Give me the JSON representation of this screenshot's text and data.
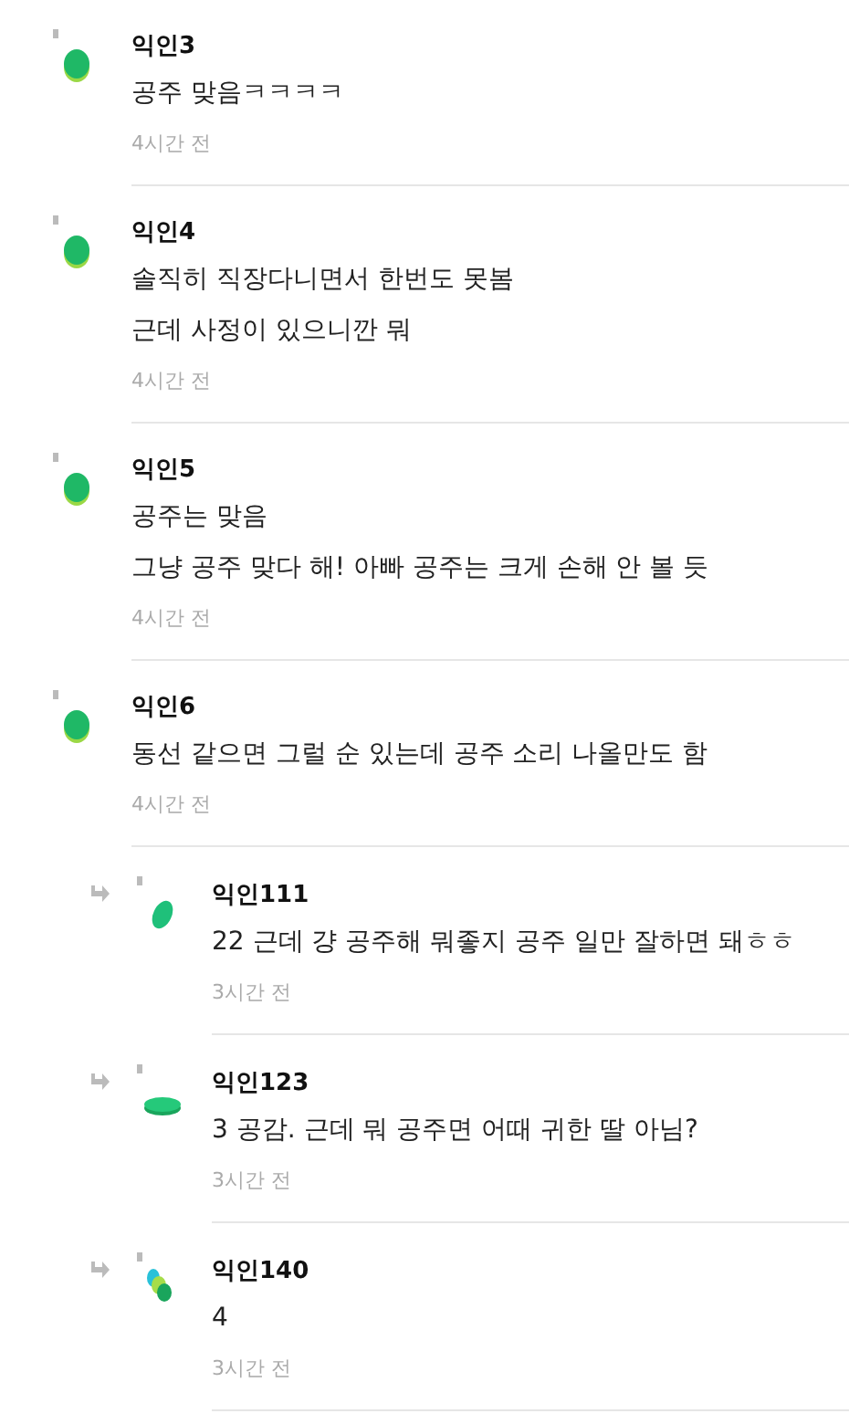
{
  "comments": [
    {
      "author": "익인3",
      "lines": [
        "공주 맞음ㅋㅋㅋㅋ"
      ],
      "time": "4시간 전",
      "kind": "blob"
    },
    {
      "author": "익인4",
      "lines": [
        "솔직히 직장다니면서 한번도 못봄",
        "근데 사정이 있으니깐 뭐"
      ],
      "time": "4시간 전",
      "kind": "blob"
    },
    {
      "author": "익인5",
      "lines": [
        "공주는 맞음",
        "그냥 공주 맞다 해! 아빠 공주는 크게 손해 안 볼 듯"
      ],
      "time": "4시간 전",
      "kind": "blob"
    },
    {
      "author": "익인6",
      "lines": [
        "동선 같으면 그럴 순 있는데 공주 소리 나올만도 함"
      ],
      "time": "4시간 전",
      "kind": "blob",
      "children": [
        {
          "author": "익인111",
          "lines": [
            "22 근데 걍 공주해 뭐좋지 공주 일만 잘하면 돼ㅎㅎ"
          ],
          "time": "3시간 전",
          "kind": "tilted"
        },
        {
          "author": "익인123",
          "lines": [
            "3 공감. 근데 뭐 공주면 어때 귀한 딸 아님?"
          ],
          "time": "3시간 전",
          "kind": "flat"
        },
        {
          "author": "익인140",
          "lines": [
            "4"
          ],
          "time": "3시간 전",
          "kind": "dots"
        }
      ]
    }
  ]
}
